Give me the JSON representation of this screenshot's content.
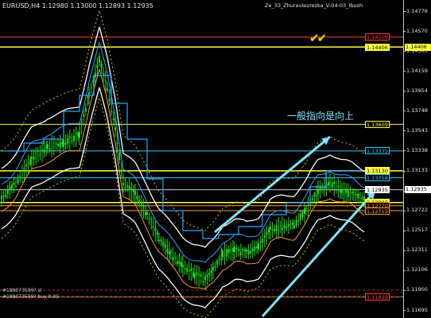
{
  "header": {
    "symbol_info": "EURUSD,H4  1.12980 1.13000 1.12893 1.12935",
    "template_name": "Ze_33_Zhuravlevrezka_V-04-03_Ibush"
  },
  "annotation": {
    "text": "一般指向是向上",
    "checkmarks": "✔✔"
  },
  "price_scale": {
    "ticks": [
      "1.14776",
      "1.14570",
      "1.14365",
      "1.14159",
      "1.13954",
      "1.13748",
      "1.13543",
      "1.13338",
      "1.13133",
      "1.12927",
      "1.12722",
      "1.12517",
      "1.12311",
      "1.12106",
      "1.11900",
      "1.11695"
    ],
    "level_tags": [
      {
        "id": "l14509",
        "price": "1.14509",
        "color": "#ff3b3b",
        "bg": "#000000",
        "border": "#ff3b3b"
      },
      {
        "id": "l14406",
        "price": "1.14406",
        "color": "#000000",
        "bg": "#ffff40",
        "border": "#ffff40"
      },
      {
        "id": "l13609",
        "price": "1.13609",
        "color": "#ffff40",
        "bg": "#000000",
        "border": "#ffff40"
      },
      {
        "id": "l13335",
        "price": "1.13335",
        "color": "#33c6ff",
        "bg": "#000000",
        "border": "#33c6ff"
      },
      {
        "id": "l13130",
        "price": "1.13130",
        "color": "#000000",
        "bg": "#ffff40",
        "border": "#ffff40"
      },
      {
        "id": "l13058",
        "price": "1.13058",
        "color": "#33c6ff",
        "bg": "#000000",
        "border": "#33c6ff"
      },
      {
        "id": "l12935",
        "price": "1.12935",
        "color": "#000000",
        "bg": "#ffffff",
        "border": "#ffffff"
      },
      {
        "id": "l12803",
        "price": "1.12803",
        "color": "#000000",
        "bg": "#ffff40",
        "border": "#ffff40"
      },
      {
        "id": "l12770",
        "price": "1.12770",
        "color": "#ff9a2e",
        "bg": "#000000",
        "border": "#ff9a2e"
      },
      {
        "id": "l12719",
        "price": "1.12719",
        "color": "#ff9a2e",
        "bg": "#000000",
        "border": "#ff9a2e"
      },
      {
        "id": "l11829",
        "price": "1.11829",
        "color": "#ff3b3b",
        "bg": "#000000",
        "border": "#ff3b3b"
      }
    ]
  },
  "orders": [
    {
      "text": "#188073599?  sl"
    },
    {
      "text": "#188073599?  buy 0.05"
    }
  ],
  "colors": {
    "background": "#000000",
    "candle": "#22dd22",
    "bollinger": "#ffffff",
    "channel": "#2aa8ff",
    "stop_line": "#ff9a2e",
    "ma_dotted": "#c8c800",
    "trend_arrows": "#7fe6ff",
    "resistance": "#ffff40",
    "annotation_text": "#7fe6ff"
  }
}
